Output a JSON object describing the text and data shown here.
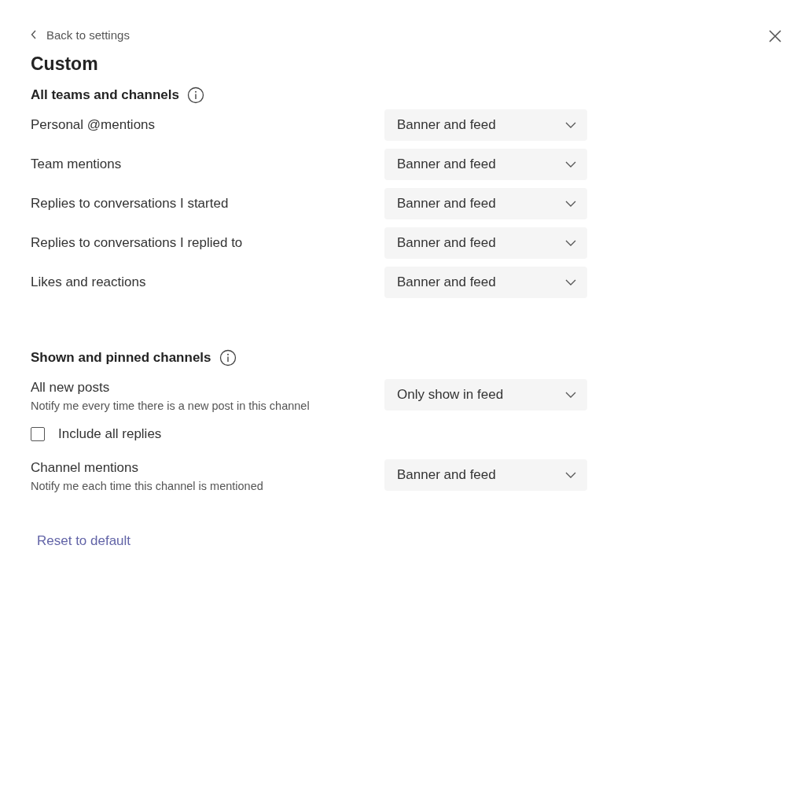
{
  "back_link": "Back to settings",
  "title": "Custom",
  "sections": [
    {
      "heading": "All teams and channels",
      "rows": [
        {
          "kind": "dropdown",
          "label": "Personal @mentions",
          "value": "Banner and feed"
        },
        {
          "kind": "dropdown",
          "label": "Team mentions",
          "value": "Banner and feed"
        },
        {
          "kind": "dropdown",
          "label": "Replies to conversations I started",
          "value": "Banner and feed"
        },
        {
          "kind": "dropdown",
          "label": "Replies to conversations I replied to",
          "value": "Banner and feed"
        },
        {
          "kind": "dropdown",
          "label": "Likes and reactions",
          "value": "Banner and feed"
        }
      ]
    },
    {
      "heading": "Shown and pinned channels",
      "rows": [
        {
          "kind": "dropdown",
          "label": "All new posts",
          "description": "Notify me every time there is a new post in this channel",
          "value": "Only show in feed"
        },
        {
          "kind": "checkbox",
          "label": "Include all replies",
          "checked": false
        },
        {
          "kind": "dropdown",
          "label": "Channel mentions",
          "description": "Notify me each time this channel is mentioned",
          "value": "Banner and feed"
        }
      ]
    }
  ],
  "reset_link": "Reset to default"
}
